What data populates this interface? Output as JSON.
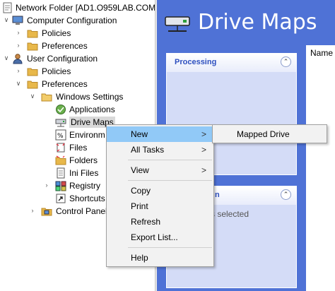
{
  "tree": {
    "root": "Network Folder [AD1.O959LAB.COM]",
    "computer_config": "Computer Configuration",
    "cc_policies": "Policies",
    "cc_preferences": "Preferences",
    "user_config": "User Configuration",
    "uc_policies": "Policies",
    "uc_preferences": "Preferences",
    "windows_settings": "Windows Settings",
    "applications": "Applications",
    "drive_maps": "Drive Maps",
    "environment": "Environm",
    "files": "Files",
    "folders": "Folders",
    "ini_files": "Ini Files",
    "registry": "Registry",
    "shortcuts": "Shortcuts",
    "control_panel": "Control Panel"
  },
  "right": {
    "title": "Drive Maps",
    "processing": "Processing",
    "panel2_title": "n",
    "panel2_text": "s selected",
    "name_header": "Name"
  },
  "menu": {
    "new": "New",
    "all_tasks": "All Tasks",
    "view": "View",
    "copy": "Copy",
    "print": "Print",
    "refresh": "Refresh",
    "export": "Export List...",
    "help": "Help",
    "arrow": ">"
  },
  "submenu": {
    "mapped_drive": "Mapped Drive"
  },
  "colors": {
    "accent": "#4f72d6",
    "highlight": "#91c9f7",
    "folder": "#e8b84a"
  }
}
